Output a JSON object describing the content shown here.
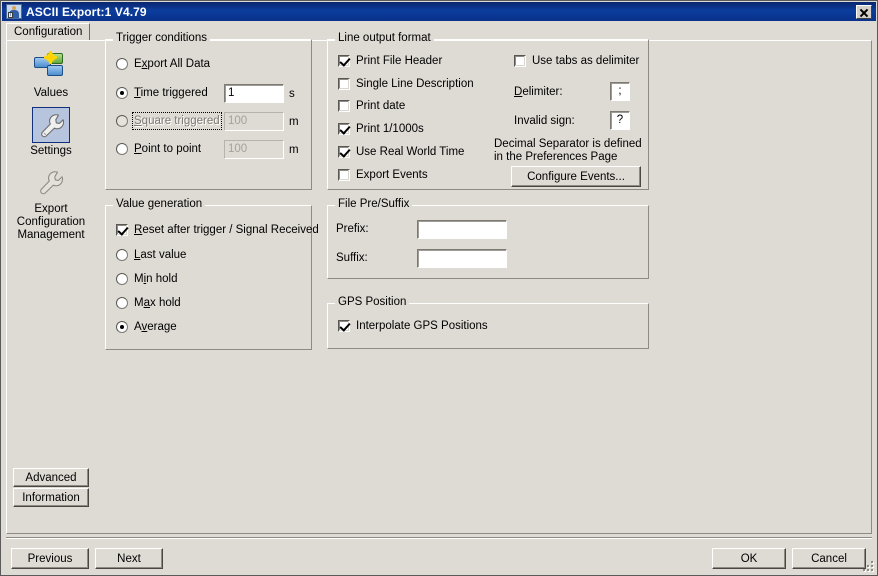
{
  "window": {
    "title": "ASCII Export:1 V4.79",
    "icon": "user-icon",
    "close_label": "✕"
  },
  "tabs": [
    {
      "label": "Configuration",
      "selected": true
    }
  ],
  "sidebar": {
    "items": [
      {
        "label": "Values",
        "icon": "values-icon",
        "selected": false
      },
      {
        "label": "Settings",
        "icon": "wrench-icon",
        "selected": true
      },
      {
        "label": "Export\nConfiguration\nManagement",
        "label_line1": "Export",
        "label_line2": "Configuration",
        "label_line3": "Management",
        "icon": "wrench-grey-icon",
        "selected": false
      }
    ]
  },
  "groups": {
    "trigger_conditions": {
      "title": "Trigger conditions",
      "options": [
        {
          "label": "Export All Data",
          "accel": "x",
          "checked": false,
          "disabled": false
        },
        {
          "label": "Time triggered",
          "accel": "T",
          "checked": true,
          "disabled": false
        },
        {
          "label": "Square triggered",
          "accel": "S",
          "checked": false,
          "disabled": true,
          "focused": true
        },
        {
          "label": "Point to point",
          "accel": "P",
          "checked": false,
          "disabled": false
        }
      ],
      "fields": [
        {
          "value": "1",
          "unit": "s",
          "disabled": false
        },
        {
          "value": "100",
          "unit": "m",
          "disabled": true
        },
        {
          "value": "100",
          "unit": "m",
          "disabled": true
        }
      ]
    },
    "value_generation": {
      "title": "Value generation",
      "reset_checkbox": {
        "label": "Reset after trigger / Signal Received",
        "checked": true
      },
      "options": [
        {
          "label": "Last value",
          "checked": false
        },
        {
          "label": "Min hold",
          "checked": false
        },
        {
          "label": "Max hold",
          "checked": false
        },
        {
          "label": "Average",
          "checked": true
        }
      ]
    },
    "line_output_format": {
      "title": "Line output format",
      "left_checkboxes": [
        {
          "label": "Print File Header",
          "checked": true
        },
        {
          "label": "Single Line Description",
          "checked": false
        },
        {
          "label": "Print date",
          "checked": false
        },
        {
          "label": "Print 1/1000s",
          "checked": true
        },
        {
          "label": "Use Real World Time",
          "checked": true
        },
        {
          "label": "Export Events",
          "checked": false
        }
      ],
      "use_tabs_checkbox": {
        "label": "Use tabs as delimiter",
        "checked": false
      },
      "delimiter_label": "Delimiter:",
      "delimiter_value": ";",
      "invalid_sign_label": "Invalid sign:",
      "invalid_sign_value": "?",
      "note_line1": "Decimal Separator is defined",
      "note_line2": "in the Preferences Page",
      "configure_events_button": "Configure Events..."
    },
    "file_pre_suffix": {
      "title": "File Pre/Suffix",
      "prefix_label": "Prefix:",
      "prefix_value": "",
      "suffix_label": "Suffix:",
      "suffix_value": ""
    },
    "gps_position": {
      "title": "GPS Position",
      "interpolate_checkbox": {
        "label": "Interpolate GPS Positions",
        "checked": true
      }
    }
  },
  "side_buttons": {
    "advanced": "Advanced",
    "information": "Information"
  },
  "footer": {
    "previous": "Previous",
    "next": "Next",
    "ok": "OK",
    "cancel": "Cancel"
  },
  "colors": {
    "face": "#dedad4",
    "titlebar": "#0b3d9e",
    "selection": "#b6c4de",
    "selection_border": "#10307c",
    "field_bg": "#ffffff",
    "disabled_text": "#a5a19b"
  }
}
